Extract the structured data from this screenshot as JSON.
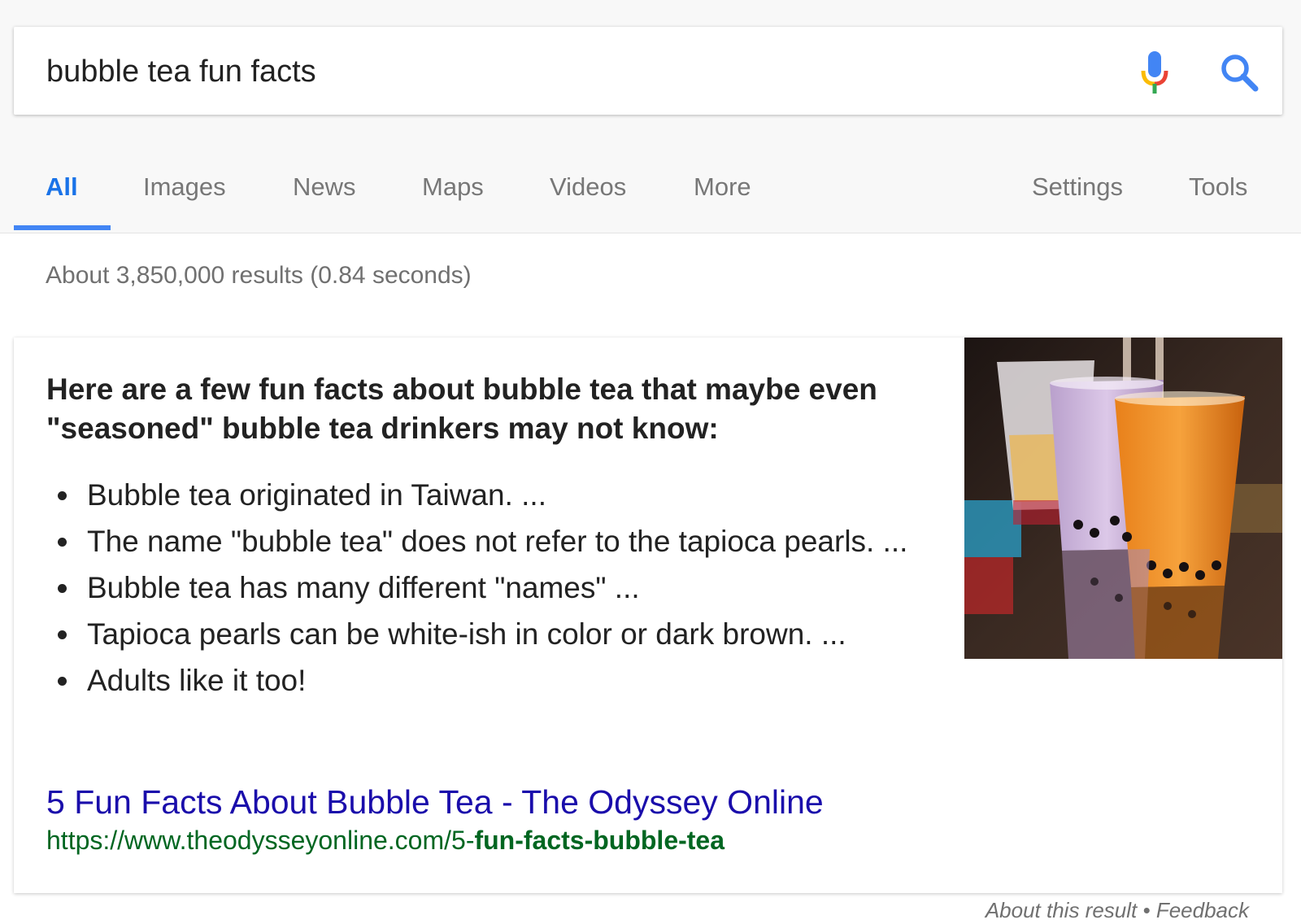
{
  "search": {
    "query": "bubble tea fun facts",
    "mic_icon": "mic-icon",
    "search_icon": "search-icon"
  },
  "tabs": [
    {
      "label": "All",
      "active": true
    },
    {
      "label": "Images"
    },
    {
      "label": "News"
    },
    {
      "label": "Maps"
    },
    {
      "label": "Videos"
    },
    {
      "label": "More"
    }
  ],
  "right_tabs": [
    {
      "label": "Settings"
    },
    {
      "label": "Tools"
    }
  ],
  "results_stats": "About 3,850,000 results (0.84 seconds)",
  "snippet": {
    "heading": "Here are a few fun facts about bubble tea that maybe even \"seasoned\" bubble tea drinkers may not know:",
    "facts": [
      "Bubble tea originated in Taiwan. ...",
      "The name \"bubble tea\" does not refer to the tapioca pearls. ...",
      "Bubble tea has many different \"names\" ...",
      "Tapioca pearls can be white-ish in color or dark brown. ...",
      "Adults like it too!"
    ],
    "title": "5 Fun Facts About Bubble Tea - The Odyssey Online",
    "url_prefix": "https://www.theodysseyonline.com/5-",
    "url_bold": "fun-facts-bubble-tea"
  },
  "footer": {
    "about": "About this result",
    "separator": " • ",
    "feedback": "Feedback"
  },
  "colors": {
    "accent": "#4285f4",
    "link": "#1a0dab",
    "url": "#006621"
  }
}
